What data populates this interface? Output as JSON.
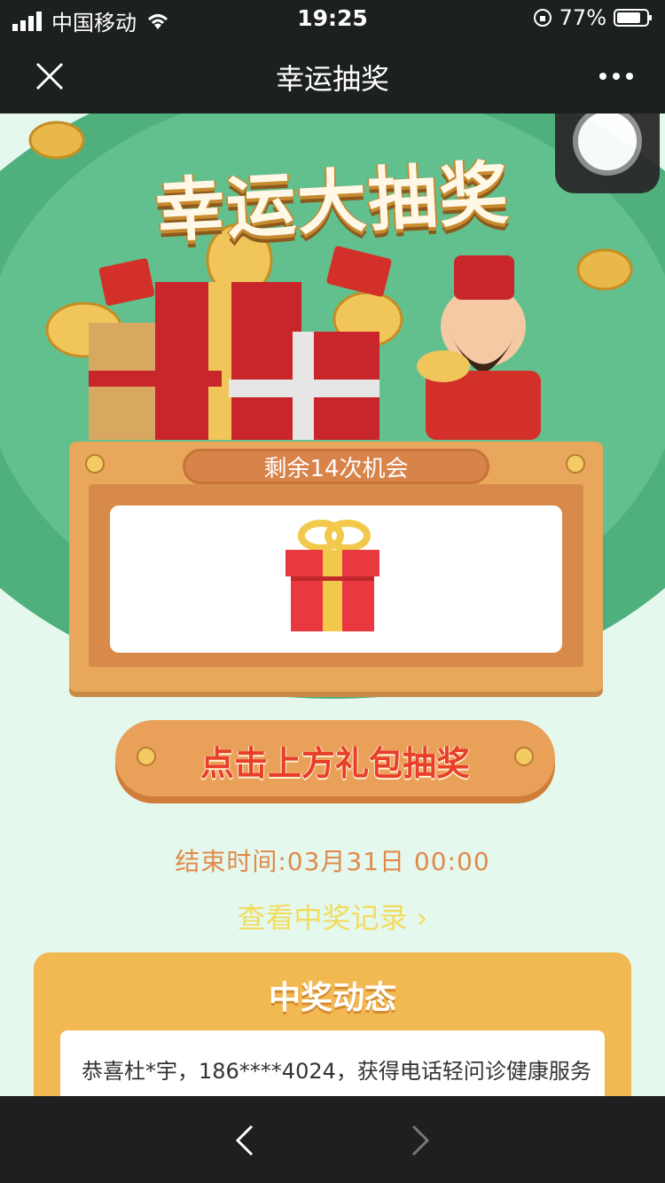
{
  "status_bar": {
    "carrier": "中国移动",
    "time": "19:25",
    "battery": "77%"
  },
  "nav": {
    "title": "幸运抽奖"
  },
  "hero": {
    "title": "幸运大抽奖"
  },
  "board": {
    "chances": "剩余14次机会"
  },
  "draw_button": {
    "label": "点击上方礼包抽奖"
  },
  "info": {
    "end_time": "结束时间:03月31日 00:00",
    "records_link": "查看中奖记录 ›"
  },
  "news": {
    "title": "中奖动态",
    "items": [
      "恭喜杜*宇，186****4024，获得电话轻问诊健康服务"
    ]
  },
  "colors": {
    "primary_green": "#4fb07e",
    "orange": "#e9a15a",
    "accent_red": "#e83e2a"
  }
}
